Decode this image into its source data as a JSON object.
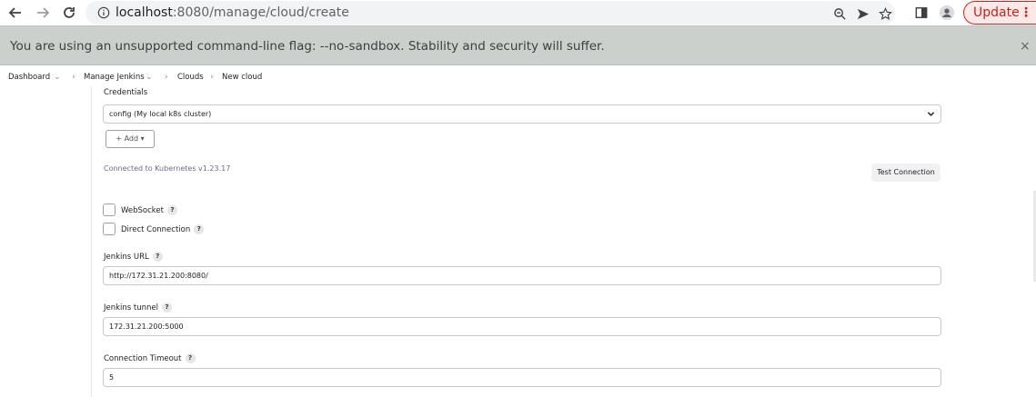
{
  "browser": {
    "url_host": "localhost",
    "url_rest": ":8080/manage/cloud/create",
    "update_label": "Update",
    "update_menu": "⋮"
  },
  "infobar": {
    "message": "You are using an unsupported command-line flag: --no-sandbox. Stability and security will suffer.",
    "close": "×"
  },
  "breadcrumb": {
    "items": [
      {
        "label": "Dashboard"
      },
      {
        "label": "Manage Jenkins"
      },
      {
        "label": "Clouds"
      },
      {
        "label": "New cloud"
      }
    ]
  },
  "form": {
    "credentials_label": "Credentials",
    "credentials_value": "config (My local k8s cluster)",
    "add_label": "+ Add ▾",
    "connected_text": "Connected to Kubernetes v1.23.17",
    "test_connection_label": "Test Connection",
    "websocket_label": "WebSocket",
    "direct_connection_label": "Direct Connection",
    "jenkins_url_label": "Jenkins URL",
    "jenkins_url_value": "http://172.31.21.200:8080/",
    "jenkins_tunnel_label": "Jenkins tunnel",
    "jenkins_tunnel_value": "172.31.21.200:5000",
    "connection_timeout_label": "Connection Timeout",
    "connection_timeout_value": "5",
    "help_glyph": "?"
  },
  "colors": {
    "update_accent": "#c5221f",
    "infobar_bg": "#cbd0cc"
  }
}
